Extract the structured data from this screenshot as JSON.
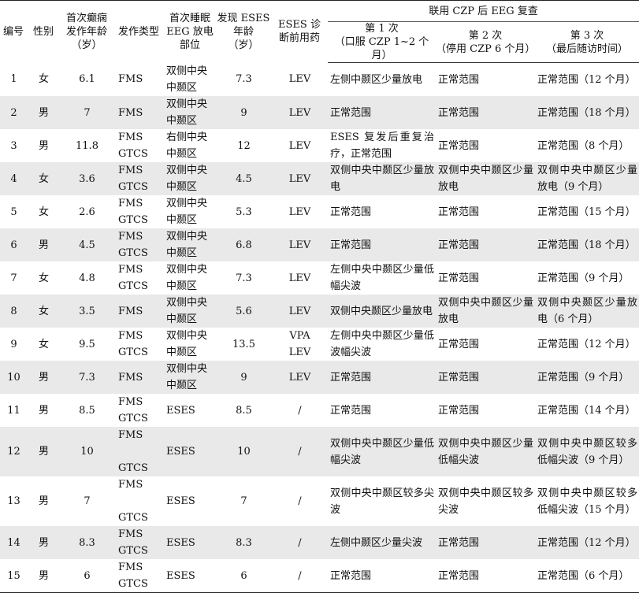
{
  "table": {
    "headers": {
      "id": "编号",
      "sex": "性别",
      "onset_age": "首次癫痫\n发作年龄\n（岁）",
      "seizure_type": "发作类型",
      "eeg_site": "首次睡眠\nEEG 放电\n部位",
      "eses_age": "发现 ESES\n年龄\n（岁）",
      "pre_drug": "ESES 诊\n断前用药",
      "followup_group": "联用 CZP 后 EEG 复查",
      "followup_1": "第 1 次\n（口服 CZP 1~2 个月）",
      "followup_2": "第 2 次\n（停用 CZP 6 个月）",
      "followup_3": "第 3 次\n（最后随访时间）"
    },
    "rows": [
      {
        "id": "1",
        "sex": "女",
        "onset_age": "6.1",
        "seizure_type": "FMS",
        "eeg_site": "双侧中央\n中颞区",
        "eses_age": "7.3",
        "pre_drug": "LEV",
        "f1": "左侧中颞区少量放电",
        "f2": "正常范围",
        "f3": "正常范围（12 个月）"
      },
      {
        "id": "2",
        "sex": "男",
        "onset_age": "7",
        "seizure_type": "FMS",
        "eeg_site": "双侧中央\n中颞区",
        "eses_age": "9",
        "pre_drug": "LEV",
        "f1": "正常范围",
        "f2": "正常范围",
        "f3": "正常范围（18 个月）"
      },
      {
        "id": "3",
        "sex": "男",
        "onset_age": "11.8",
        "seizure_type": "FMS\nGTCS",
        "eeg_site": "右侧中央\n中颞区",
        "eses_age": "12",
        "pre_drug": "LEV",
        "f1": "ESES 复发后重复治疗，正常范围",
        "f2": "正常范围",
        "f3": "正常范围（8 个月）"
      },
      {
        "id": "4",
        "sex": "女",
        "onset_age": "3.6",
        "seizure_type": "FMS\nGTCS",
        "eeg_site": "双侧中央\n中颞区",
        "eses_age": "4.5",
        "pre_drug": "LEV",
        "f1": "双侧中央中颞区少量放电",
        "f2": "双侧中央中颞区少量放电",
        "f3": "双侧中央中颞区少量放电（9 个月）"
      },
      {
        "id": "5",
        "sex": "女",
        "onset_age": "2.6",
        "seizure_type": "FMS\nGTCS",
        "eeg_site": "双侧中央\n中颞区",
        "eses_age": "5.3",
        "pre_drug": "LEV",
        "f1": "正常范围",
        "f2": "正常范围",
        "f3": "正常范围（15 个月）"
      },
      {
        "id": "6",
        "sex": "男",
        "onset_age": "4.5",
        "seizure_type": "FMS\nGTCS",
        "eeg_site": "双侧中央\n中颞区",
        "eses_age": "6.8",
        "pre_drug": "LEV",
        "f1": "正常范围",
        "f2": "正常范围",
        "f3": "正常范围（18 个月）"
      },
      {
        "id": "7",
        "sex": "女",
        "onset_age": "4.8",
        "seizure_type": "FMS\nGTCS",
        "eeg_site": "双侧中央\n中颞区",
        "eses_age": "7.3",
        "pre_drug": "LEV",
        "f1": "左侧中央中颞区少量低幅尖波",
        "f2": "正常范围",
        "f3": "正常范围（9 个月）"
      },
      {
        "id": "8",
        "sex": "女",
        "onset_age": "3.5",
        "seizure_type": "FMS",
        "eeg_site": "双侧中央\n中颞区",
        "eses_age": "5.6",
        "pre_drug": "LEV",
        "f1": "双侧中央颞区少量放电",
        "f2": "双侧中央中颞区少量放电",
        "f3": "双侧中央颞区少量放电（6 个月）"
      },
      {
        "id": "9",
        "sex": "女",
        "onset_age": "9.5",
        "seizure_type": "FMS\nGTCS",
        "eeg_site": "双侧中央\n中颞区",
        "eses_age": "13.5",
        "pre_drug": "VPA\nLEV",
        "f1": "左侧中央中颞区少量低波幅尖波",
        "f2": "正常范围",
        "f3": "正常范围（12 个月）"
      },
      {
        "id": "10",
        "sex": "男",
        "onset_age": "7.3",
        "seizure_type": "FMS",
        "eeg_site": "双侧中央\n中颞区",
        "eses_age": "9",
        "pre_drug": "LEV",
        "f1": "正常范围",
        "f2": "正常范围",
        "f3": "正常范围（9 个月）"
      },
      {
        "id": "11",
        "sex": "男",
        "onset_age": "8.5",
        "seizure_type": "FMS\nGTCS",
        "eeg_site": "ESES",
        "eses_age": "8.5",
        "pre_drug": "/",
        "f1": "正常范围",
        "f2": "正常范围",
        "f3": "正常范围（14 个月）"
      },
      {
        "id": "12",
        "sex": "男",
        "onset_age": "10",
        "seizure_type": "FMS\n\nGTCS",
        "eeg_site": "ESES",
        "eses_age": "10",
        "pre_drug": "/",
        "f1": "双侧中央中颞区少量低幅尖波",
        "f2": "双侧中央中颞区少量低幅尖波",
        "f3": "双侧中央中颞区较多低幅尖波（9 个月）"
      },
      {
        "id": "13",
        "sex": "男",
        "onset_age": "7",
        "seizure_type": "FMS\n\nGTCS",
        "eeg_site": "ESES",
        "eses_age": "7",
        "pre_drug": "/",
        "f1": "双侧中央中颞区较多尖波",
        "f2": "双侧中央中颞区较多尖波",
        "f3": "双侧中央中颞区较多低幅尖波（15 个月）"
      },
      {
        "id": "14",
        "sex": "男",
        "onset_age": "8.3",
        "seizure_type": "FMS\nGTCS",
        "eeg_site": "ESES",
        "eses_age": "8.3",
        "pre_drug": "/",
        "f1": "左侧中颞区少量尖波",
        "f2": "正常范围",
        "f3": "正常范围（12 个月）"
      },
      {
        "id": "15",
        "sex": "男",
        "onset_age": "6",
        "seizure_type": "FMS\nGTCS",
        "eeg_site": "ESES",
        "eses_age": "6",
        "pre_drug": "/",
        "f1": "正常范围",
        "f2": "正常范围",
        "f3": "正常范围（6 个月）"
      }
    ]
  }
}
